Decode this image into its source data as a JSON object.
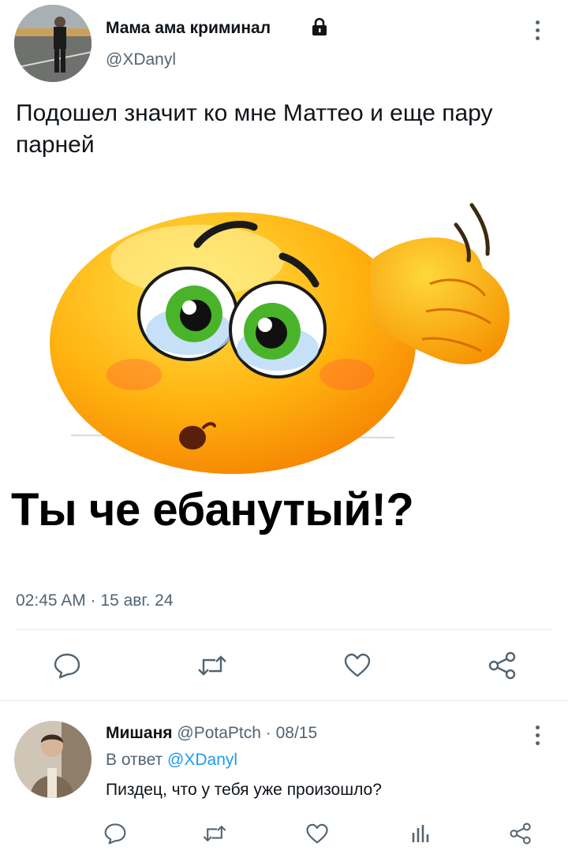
{
  "tweet": {
    "author_name": "Мама ама криминал",
    "author_handle": "@XDanyl",
    "text": "Подошел значит ко мне Маттео и еще пару парней",
    "meme_caption": "Ты че ебанутый!?",
    "timestamp": "02:45 AM · 15 авг. 24",
    "lock_icon": "lock-icon"
  },
  "actions": [
    "reply-icon",
    "retweet-icon",
    "like-icon",
    "share-icon"
  ],
  "reply": {
    "author_name": "Мишаня",
    "author_handle": "@PotaPtch",
    "date": "· 08/15",
    "reply_to_prefix": "В ответ",
    "reply_to_handle": "@XDanyl",
    "text": "Пиздец, что у тебя уже произошло?"
  },
  "reply_actions": [
    "reply-icon",
    "retweet-icon",
    "like-icon",
    "analytics-icon",
    "share-icon"
  ],
  "colors": {
    "link": "#1d9bf0",
    "secondary": "#536471",
    "text": "#0f1419"
  }
}
